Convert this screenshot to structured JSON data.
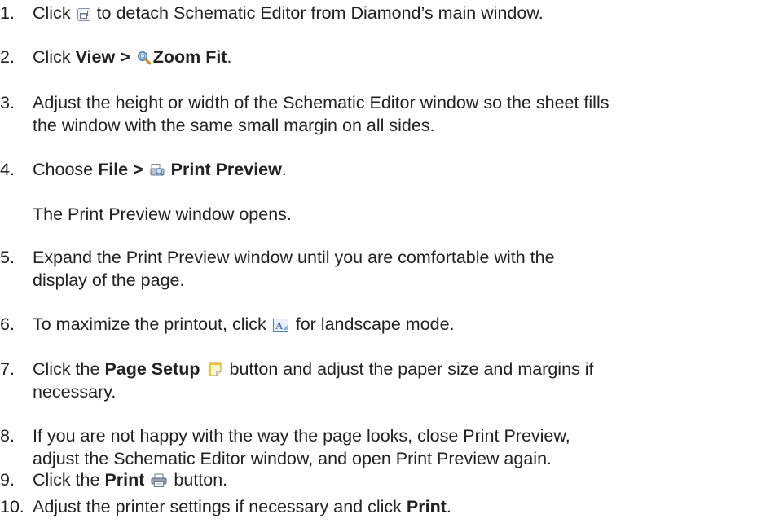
{
  "steps": [
    {
      "num": "1.",
      "before": "Click",
      "icon": "detach-icon",
      "after": "to detach Schematic Editor from Diamond’s main window."
    },
    {
      "num": "2.",
      "before": "Click",
      "bold1": "View >",
      "icon": "zoom-fit-icon",
      "bold2": "Zoom Fit",
      "after": "."
    },
    {
      "num": "3.",
      "line1": "Adjust the height or width of the Schematic Editor window so the sheet fills",
      "line2": "the window with the same small margin on all sides."
    },
    {
      "num": "4.",
      "before": "Choose",
      "bold1": "File >",
      "icon": "print-preview-icon",
      "bold2": "Print Preview",
      "after": "."
    },
    {
      "note": "The Print Preview window opens."
    },
    {
      "num": "5.",
      "line1": "Expand the Print Preview window until you are comfortable with the",
      "line2": "display of the page."
    },
    {
      "num": "6.",
      "before": "To maximize the printout, click",
      "icon": "landscape-icon",
      "after": "for landscape mode."
    },
    {
      "num": "7.",
      "before": "Click the",
      "bold1": "Page Setup",
      "icon": "page-setup-icon",
      "after": "button and adjust the paper size and margins if",
      "line2": "necessary."
    },
    {
      "num": "8.",
      "line1": "If you are not happy with the way the page looks, close Print Preview,",
      "line2": "adjust the Schematic Editor window, and open Print Preview again."
    },
    {
      "num": "9.",
      "before": "Click the",
      "bold1": "Print",
      "icon": "printer-icon",
      "after": "button."
    },
    {
      "num": "10.",
      "before": "Adjust the printer settings if necessary and click",
      "bold1": "Print",
      "after": "."
    }
  ]
}
